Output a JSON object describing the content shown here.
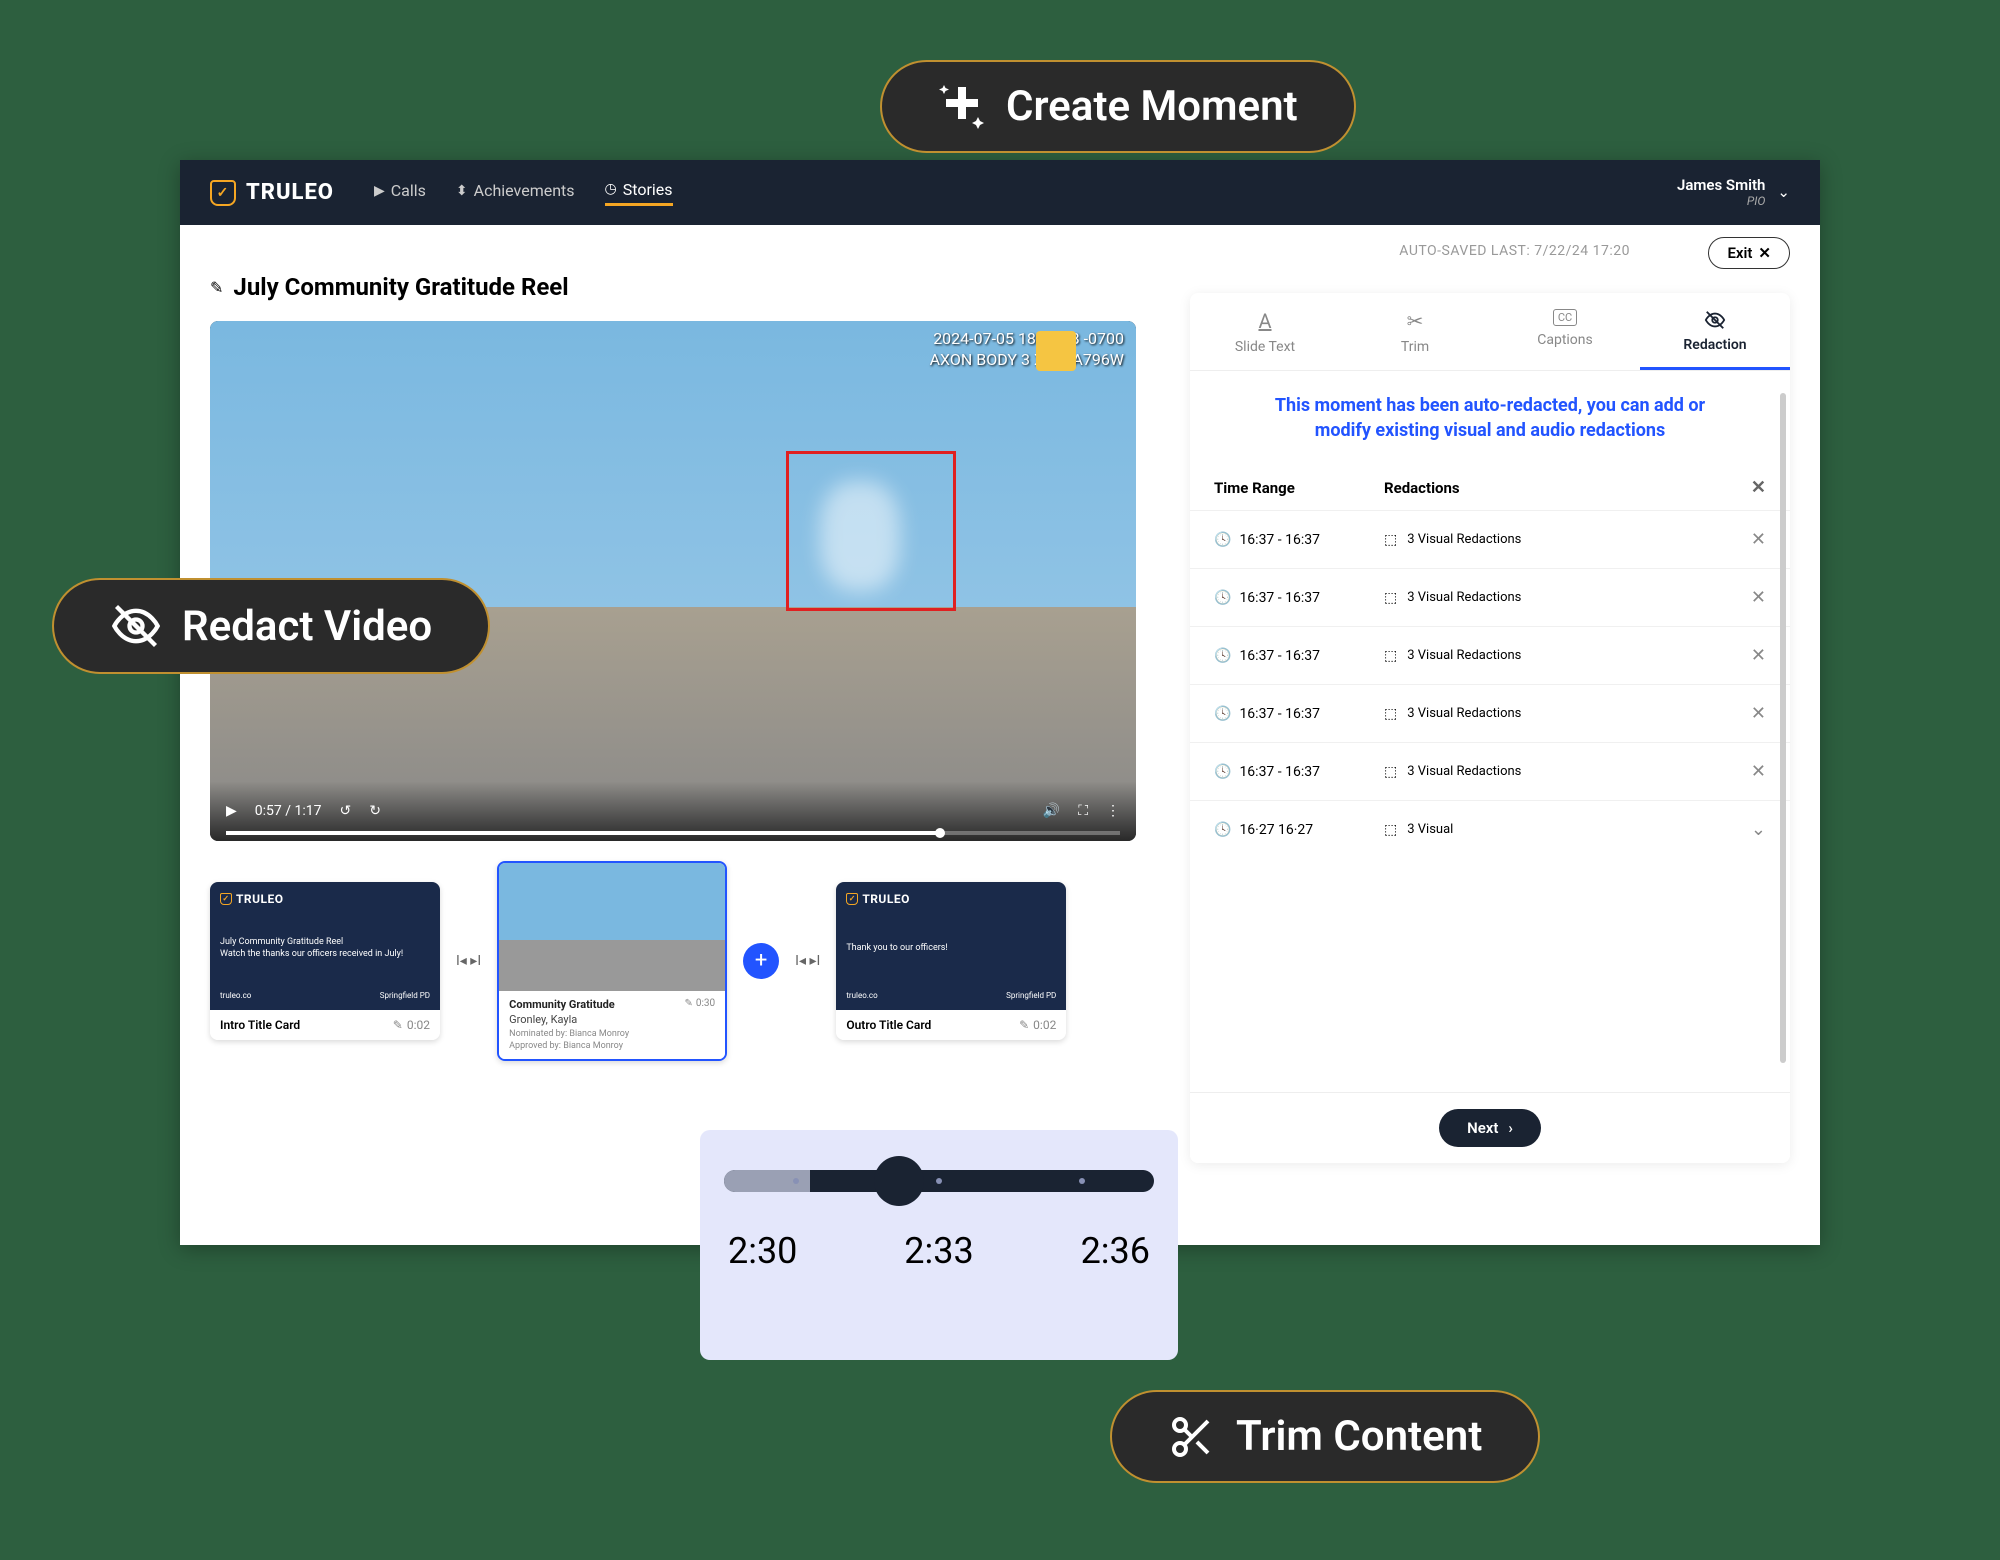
{
  "brand": "TRULEO",
  "nav": {
    "calls": "Calls",
    "achievements": "Achievements",
    "stories": "Stories"
  },
  "user": {
    "name": "James Smith",
    "role": "PIO"
  },
  "autosave": "AUTO-SAVED LAST: 7/22/24 17:20",
  "exit": "Exit",
  "title": "July Community Gratitude Reel",
  "video": {
    "timestamp_line1": "2024-07-05 18:01:38 -0700",
    "timestamp_line2": "AXON BODY 3 X60AA796W",
    "time": "0:57 / 1:17"
  },
  "clips": [
    {
      "title": "Intro Title Card",
      "duration": "0:02",
      "line1": "July Community Gratitude Reel",
      "line2": "Watch the thanks our officers received in July!",
      "left": "truleo.co",
      "right": "Springfield PD"
    },
    {
      "title": "Community Gratitude",
      "duration": "0:30",
      "sub": "Gronley, Kayla",
      "nom": "Nominated by: Bianca Monroy",
      "app": "Approved by: Bianca Monroy"
    },
    {
      "title": "Outro Title Card",
      "duration": "0:02",
      "line1": "Thank you to our officers!",
      "left": "truleo.co",
      "right": "Springfield PD"
    }
  ],
  "tabs": {
    "slide": "Slide Text",
    "trim": "Trim",
    "captions": "Captions",
    "redaction": "Redaction"
  },
  "redaction": {
    "notice": "This moment has been auto-redacted, you can add or modify existing visual and audio redactions",
    "headers": {
      "time": "Time Range",
      "redac": "Redactions"
    },
    "item": {
      "time": "16:37 - 16:37",
      "text": "3 Visual Redactions"
    },
    "item_partial": {
      "time": "16·27  16·27",
      "text": "3 Visual"
    },
    "next": "Next"
  },
  "callouts": {
    "create": "Create Moment",
    "redact": "Redact Video",
    "trim": "Trim Content"
  },
  "scrubber": {
    "t1": "2:30",
    "t2": "2:33",
    "t3": "2:36"
  }
}
